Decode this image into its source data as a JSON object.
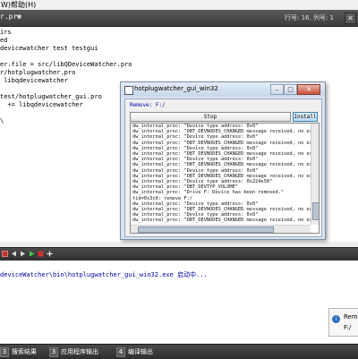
{
  "menubar": {
    "items": [
      "W)",
      "帮助(H)"
    ]
  },
  "editor_tab": {
    "file": "r.pro",
    "position": "行号: 16, 列号: 1"
  },
  "code_lines": [
    "irs",
    "ed",
    "devicewatcher test testgui",
    "",
    "er.file = src/libQDeviceWatcher.pro",
    "r/hotplugwatcher.pro",
    " libqdevicewatcher",
    "",
    "test/hotplugwatcher_gui.pro",
    "  += libqdevicewatcher",
    "",
    "\\"
  ],
  "output": {
    "lines": [
      {
        "text": "deviceWatcher\\bin\\hotplugwatcher_gui_win32.exe 启动中...",
        "color": "#0000aa"
      }
    ]
  },
  "statusbar": {
    "items": [
      {
        "num": "3",
        "label": "搜索结果"
      },
      {
        "num": "3",
        "label": "应用程序输出"
      },
      {
        "num": "4",
        "label": "编译输出"
      }
    ]
  },
  "window": {
    "title": "hotplugwatcher_gui_win32",
    "remove_label": "Remove: F:/",
    "stop_button": "Stop",
    "install_button": "Install",
    "log": [
      "dw_internal_proc: \"Device type address: 0x0\"",
      "dw_internal_proc: \"DBT_DEVNODES_CHANGED message received, no exte",
      "dw_internal_proc: \"Device type address: 0x0\"",
      "dw_internal_proc: \"DBT_DEVNODES_CHANGED message received, no exte",
      "dw_internal_proc: \"Device type address: 0x0\"",
      "dw_internal_proc: \"DBT_DEVNODES_CHANGED message received, no exte",
      "dw_internal_proc: \"Device type address: 0x0\"",
      "dw_internal_proc: \"DBT_DEVNODES_CHANGED message received, no exte",
      "dw_internal_proc: \"Device type address: 0x0\"",
      "dw_internal_proc: \"DBT_DEVNODES_CHANGED message received, no exte",
      "dw_internal_proc: \"Device type address: 0x224e50\"",
      "dw_internal_proc: \"DBT_DEVTYP_VOLUME\"",
      "dw_internal_proc: \"Drive F: Device has been removed.\"",
      "tid=0x3c0: remove F:/",
      "dw_internal_proc: \"Device type address: 0x0\"",
      "dw_internal_proc: \"DBT_DEVNODES_CHANGED message received, no exte",
      "dw_internal_proc: \"Device type address: 0x0\"",
      "dw_internal_proc: \"DBT_DEVNODES_CHANGED message received, no exte"
    ]
  },
  "toast": {
    "title": "Rem",
    "body": "F:/"
  }
}
